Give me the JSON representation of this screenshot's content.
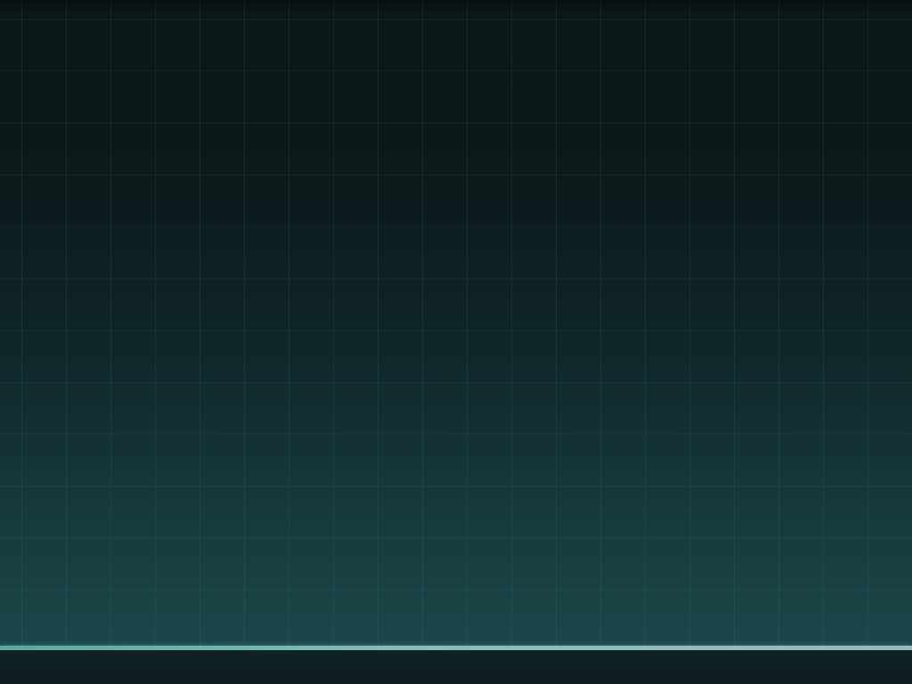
{
  "screen": {
    "background": {
      "gradient_top": "#0b1719",
      "gradient_bottom": "#1b4649",
      "grid_line_color": "#46969626"
    },
    "accent_line": {
      "color_left": "#5aa9a3",
      "color_right": "#9bb8c4"
    },
    "bottom_bar": {
      "color": "#0d1c1e"
    }
  }
}
